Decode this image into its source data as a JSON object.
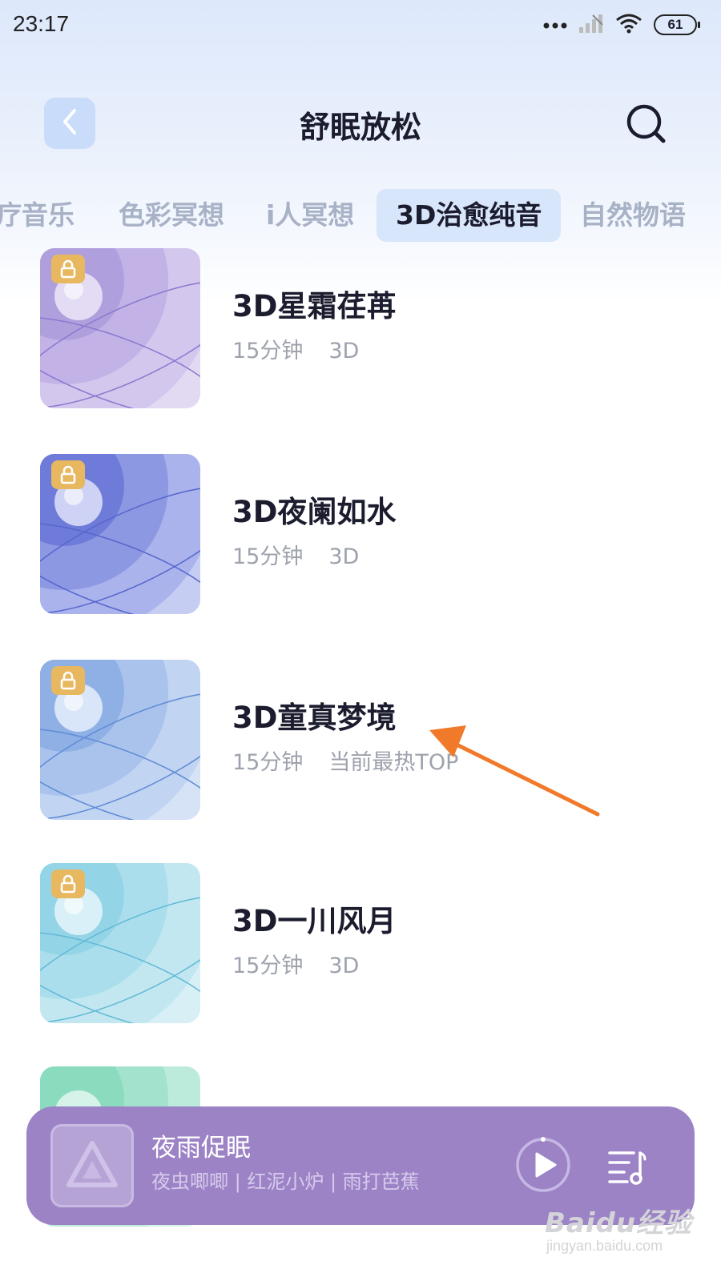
{
  "status_bar": {
    "time": "23:17",
    "battery": "61",
    "icons": [
      "more-dots-icon",
      "signal-icon",
      "wifi-icon",
      "battery-icon"
    ]
  },
  "header": {
    "title": "舒眠放松",
    "back_icon": "chevron-left-icon",
    "search_icon": "search-icon"
  },
  "tabs": [
    {
      "label": "疗音乐",
      "active": false
    },
    {
      "label": "色彩冥想",
      "active": false
    },
    {
      "label": "i人冥想",
      "active": false
    },
    {
      "label": "3D治愈纯音",
      "active": true
    },
    {
      "label": "自然物语",
      "active": false
    }
  ],
  "tracks": [
    {
      "title": "3D星霜荏苒",
      "duration": "15分钟",
      "tag": "3D",
      "locked": true,
      "color": "#a995d8"
    },
    {
      "title": "3D夜阑如水",
      "duration": "15分钟",
      "tag": "3D",
      "locked": true,
      "color": "#7f8de0"
    },
    {
      "title": "3D童真梦境",
      "duration": "15分钟",
      "tag": "当前最热TOP",
      "locked": true,
      "color": "#90b2e6"
    },
    {
      "title": "3D一川风月",
      "duration": "15分钟",
      "tag": "3D",
      "locked": true,
      "color": "#8fd3e8"
    },
    {
      "title": "",
      "duration": "",
      "tag": "",
      "locked": true,
      "color": "#8fdcc0"
    }
  ],
  "player": {
    "title": "夜雨促眠",
    "subtitle": "夜虫唧唧 | 红泥小炉 | 雨打芭蕉",
    "background": "#9c83c6"
  },
  "watermark": {
    "logo_text": "Baidu经验",
    "url": "jingyan.baidu.com"
  },
  "colors": {
    "annotation_arrow": "#f07a2a",
    "lock_badge": "#e8b860",
    "active_tab_bg": "#d8e6fb"
  }
}
